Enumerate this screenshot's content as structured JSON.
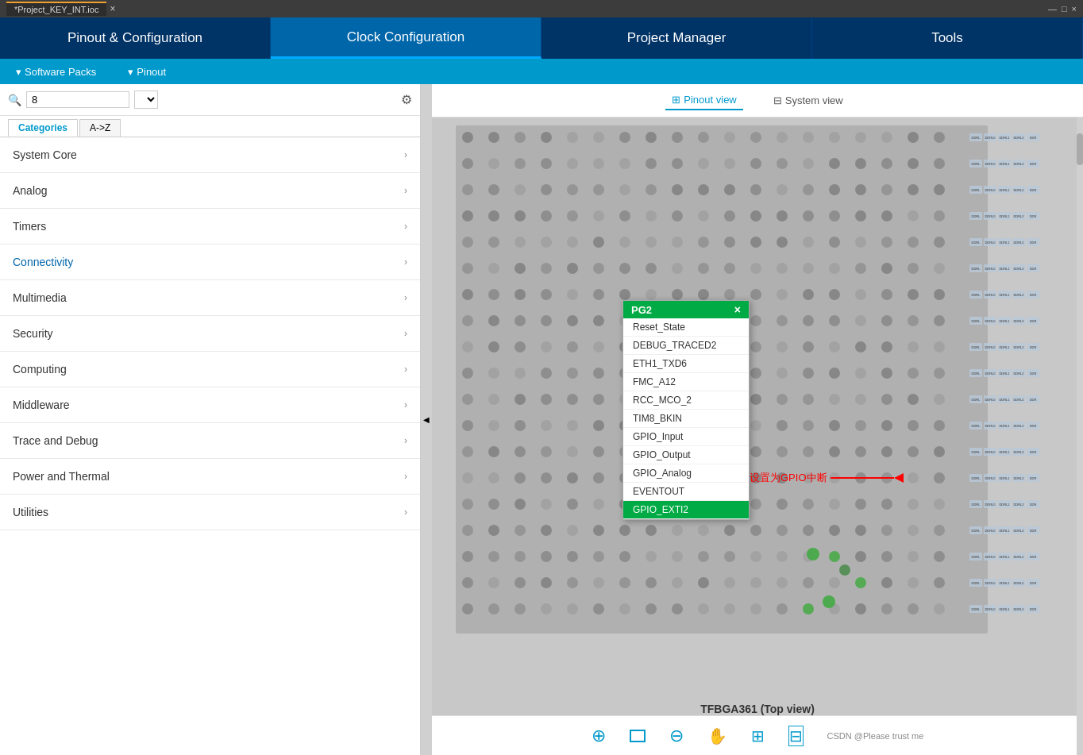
{
  "titleBar": {
    "tabLabel": "*Project_KEY_INT.ioc",
    "closeIcon": "×",
    "minimizeIcon": "—",
    "maximizeIcon": "□",
    "collapseIcon": "‹"
  },
  "mainNav": {
    "tabs": [
      {
        "id": "pinout",
        "label": "Pinout & Configuration",
        "active": false
      },
      {
        "id": "clock",
        "label": "Clock Configuration",
        "active": true
      },
      {
        "id": "project",
        "label": "Project Manager",
        "active": false
      },
      {
        "id": "tools",
        "label": "Tools",
        "active": false
      }
    ]
  },
  "subNav": {
    "items": [
      {
        "id": "software-packs",
        "label": "Software Packs",
        "icon": "▾"
      },
      {
        "id": "pinout",
        "label": "Pinout",
        "icon": "▾"
      }
    ]
  },
  "search": {
    "value": "8",
    "placeholder": "",
    "gearLabel": "⚙",
    "collapseLabel": "◀"
  },
  "categoryTabs": [
    {
      "id": "categories",
      "label": "Categories",
      "active": true
    },
    {
      "id": "az",
      "label": "A->Z",
      "active": false
    }
  ],
  "categories": [
    {
      "id": "system-core",
      "label": "System Core"
    },
    {
      "id": "analog",
      "label": "Analog"
    },
    {
      "id": "timers",
      "label": "Timers"
    },
    {
      "id": "connectivity",
      "label": "Connectivity"
    },
    {
      "id": "multimedia",
      "label": "Multimedia"
    },
    {
      "id": "security",
      "label": "Security"
    },
    {
      "id": "computing",
      "label": "Computing"
    },
    {
      "id": "middleware",
      "label": "Middleware"
    },
    {
      "id": "trace-debug",
      "label": "Trace and Debug"
    },
    {
      "id": "power-thermal",
      "label": "Power and Thermal"
    },
    {
      "id": "utilities",
      "label": "Utilities"
    }
  ],
  "viewToggle": {
    "pinoutLabel": "Pinout view",
    "systemLabel": "System view",
    "pinoutIcon": "⊞",
    "systemIcon": "⊟"
  },
  "chipLabel": "TFBGA361 (Top view)",
  "popup": {
    "header": "PG2",
    "closeIcon": "×",
    "items": [
      {
        "id": "reset",
        "label": "Reset_State",
        "selected": false
      },
      {
        "id": "debug-traced2",
        "label": "DEBUG_TRACED2",
        "selected": false
      },
      {
        "id": "eth1-txd6",
        "label": "ETH1_TXD6",
        "selected": false
      },
      {
        "id": "fmc-a12",
        "label": "FMC_A12",
        "selected": false
      },
      {
        "id": "rcc-mco2",
        "label": "RCC_MCO_2",
        "selected": false
      },
      {
        "id": "tim8-bkin",
        "label": "TIM8_BKIN",
        "selected": false
      },
      {
        "id": "gpio-input",
        "label": "GPIO_Input",
        "selected": false
      },
      {
        "id": "gpio-output",
        "label": "GPIO_Output",
        "selected": false
      },
      {
        "id": "gpio-analog",
        "label": "GPIO_Analog",
        "selected": false
      },
      {
        "id": "eventout",
        "label": "EVENTOUT",
        "selected": false
      },
      {
        "id": "gpio-exti2",
        "label": "GPIO_EXTI2",
        "selected": true
      }
    ]
  },
  "arrow": {
    "label": "设置为GPIO中断"
  },
  "bottomToolbar": {
    "zoomInIcon": "⊕",
    "frameIcon": "⬜",
    "zoomOutIcon": "⊖",
    "panIcon": "✋",
    "layersIcon": "⊞",
    "gridIcon": "⊟",
    "csdnLabel": "CSDN @Please trust me"
  }
}
